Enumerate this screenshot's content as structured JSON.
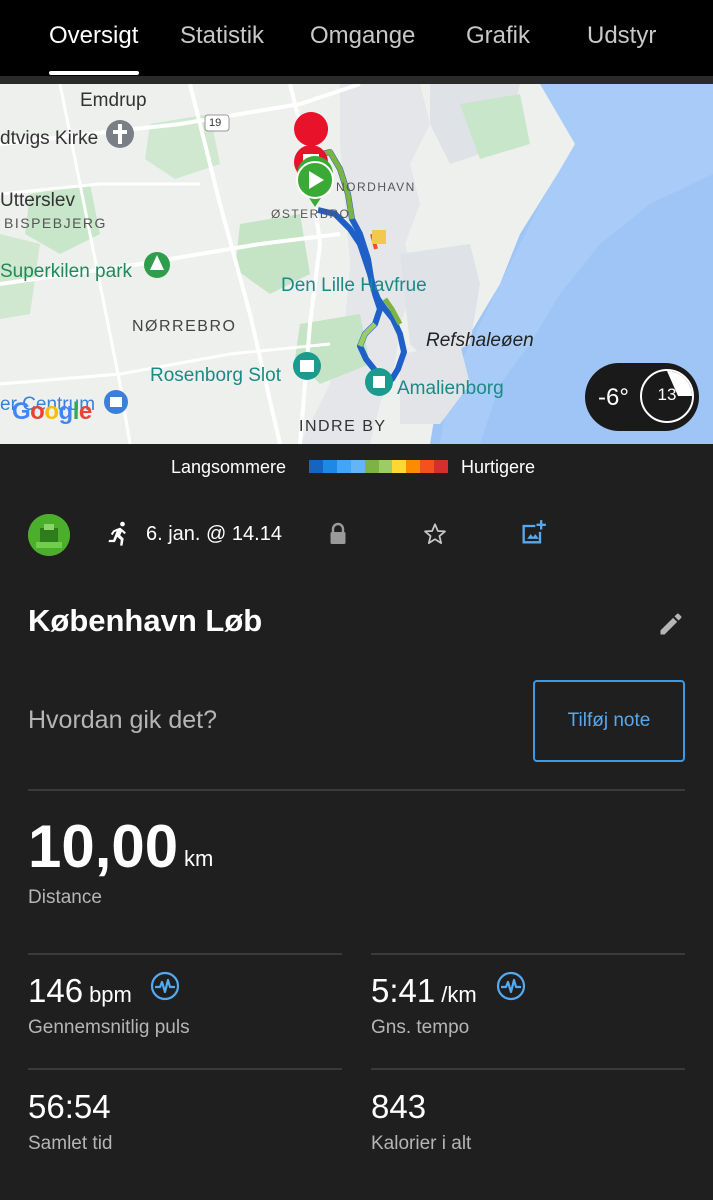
{
  "tabs": [
    "Oversigt",
    "Statistik",
    "Omgange",
    "Grafik",
    "Udstyr"
  ],
  "map": {
    "labels": {
      "emdrup": "Emdrup",
      "kirke": "dtvigs Kirke",
      "utterslev": "Utterslev",
      "bispebjerg": "BISPEBJERG",
      "superkilen": "Superkilen park",
      "norrebro": "NØRREBRO",
      "rosenborg": "Rosenborg Slot",
      "centrum": "er Centrum",
      "osterbro": "ØSTERBRO",
      "nordhavn": "NORDHAVN",
      "lille_havfrue": "Den Lille Havfrue",
      "refshaleoen": "Refshaleøen",
      "amalienborg": "Amalienborg",
      "indre_by": "INDRE BY",
      "road_19": "19",
      "google": "Google"
    },
    "weather": {
      "temp": "-6°",
      "wind": "13"
    }
  },
  "legend": {
    "slow": "Langsommere",
    "fast": "Hurtigere",
    "colors": [
      "#1565c0",
      "#1e88e5",
      "#42a5f5",
      "#64b5f6",
      "#7cb342",
      "#9ccc65",
      "#fdd835",
      "#fb8c00",
      "#f4511e",
      "#d32f2f"
    ]
  },
  "activity": {
    "date": "6. jan. @ 14.14",
    "title": "København Løb",
    "note_prompt": "Hvordan gik det?",
    "note_button": "Tilføj note"
  },
  "stats": {
    "distance": {
      "value": "10,00",
      "unit": "km",
      "label": "Distance"
    },
    "heart_rate": {
      "value": "146",
      "unit": "bpm",
      "label": "Gennemsnitlig puls"
    },
    "pace": {
      "value": "5:41",
      "unit": "/km",
      "label": "Gns. tempo"
    },
    "total_time": {
      "value": "56:54",
      "label": "Samlet tid"
    },
    "calories": {
      "value": "843",
      "label": "Kalorier i alt"
    }
  },
  "colors": {
    "accent": "#3b9ae6",
    "background": "#1f1f1f",
    "route_green": "#7cb342",
    "route_blue": "#1e5fc8",
    "start_pin": "#3aa935",
    "end_pin": "#e8132a"
  }
}
